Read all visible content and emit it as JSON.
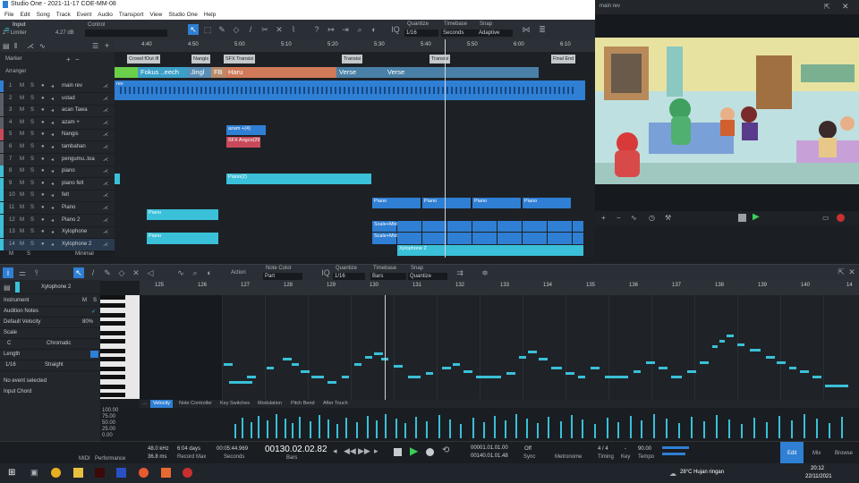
{
  "window": {
    "title": "Studio One - 2021-11-17 COE-MM-08"
  },
  "menu": [
    "File",
    "Edit",
    "Song",
    "Track",
    "Event",
    "Audio",
    "Transport",
    "View",
    "Studio One",
    "Help"
  ],
  "toolbar": {
    "input_label": "Input",
    "input_value": "2 - Limiter",
    "db_value": "4.27 dB",
    "control_label": "Control",
    "quantize_label": "Quantize",
    "quantize_value": "1/16",
    "timebase_label": "Timebase",
    "timebase_value": "Seconds",
    "snap_label": "Snap",
    "snap_value": "Adaptive"
  },
  "ruler_ticks": [
    "4:40",
    "4:50",
    "5:00",
    "5:10",
    "5:20",
    "5:30",
    "5:40",
    "5:50",
    "6:00",
    "6:10"
  ],
  "marker_label": "Marker",
  "arranger_label": "Arranger",
  "markers": [
    "Crowd fOut ifl",
    "Nangis",
    "SFX Transisi",
    "Transisi",
    "Transisi",
    "Final End"
  ],
  "arranger_sections": [
    {
      "label": "Fokus ..eech",
      "color": "#3aa0c8"
    },
    {
      "label": "Jingl",
      "color": "#5a8fb8"
    },
    {
      "label": "FB",
      "color": "#b88a6a"
    },
    {
      "label": "Haru",
      "color": "#d07a5a"
    },
    {
      "label": "Verse",
      "color": "#4a80a8"
    },
    {
      "label": "Verse",
      "color": "#4a80a8"
    }
  ],
  "tracks": [
    {
      "n": "1",
      "name": "main rev",
      "color": "#2f7fd4"
    },
    {
      "n": "2",
      "name": "ustad",
      "color": "#5a5e66"
    },
    {
      "n": "3",
      "name": "acan Tawa",
      "color": "#5a5e66"
    },
    {
      "n": "4",
      "name": "azam +",
      "color": "#5a5e66"
    },
    {
      "n": "5",
      "name": "Nangis",
      "color": "#c84a5a"
    },
    {
      "n": "6",
      "name": "tambahan",
      "color": "#5a5e66"
    },
    {
      "n": "7",
      "name": "pengumu..toa",
      "color": "#5a5e66"
    },
    {
      "n": "8",
      "name": "piano",
      "color": "#3ac0d8"
    },
    {
      "n": "9",
      "name": "piano felt",
      "color": "#3ac0d8"
    },
    {
      "n": "10",
      "name": "felt",
      "color": "#3ac0d8"
    },
    {
      "n": "11",
      "name": "Piano",
      "color": "#3ac0d8"
    },
    {
      "n": "12",
      "name": "Piano 2",
      "color": "#3ac0d8"
    },
    {
      "n": "13",
      "name": "Xylophone",
      "color": "#3ac0d8"
    },
    {
      "n": "14",
      "name": "Xylophone 2",
      "color": "#3ac0d8"
    }
  ],
  "track_footer": {
    "m": "M",
    "s": "S",
    "minimal": "Minimal"
  },
  "clip_labels": {
    "main": "rev",
    "azam": "azam +(4)",
    "sfx": "SFX Angco(29",
    "piano2": "Piano(2)",
    "piano": "Piano",
    "scale": "Scale+Mid",
    "xylo": "Xylophone 2"
  },
  "video": {
    "title": "main rev"
  },
  "editor_toolbar": {
    "action": "Action",
    "note_color_label": "Note Color",
    "note_color_value": "Part",
    "quantize_label": "Quantize",
    "quantize_value": "1/16",
    "timebase_label": "Timebase",
    "timebase_value": "Bars",
    "snap_label": "Snap",
    "snap_value": "Quantize"
  },
  "editor_left": {
    "track": "Xylophone 2",
    "instrument": "Instrument",
    "audition": "Audition Notes",
    "default_velocity": "Default Velocity",
    "default_velocity_value": "80%",
    "scale": "Scale",
    "scale_key": "C",
    "scale_mode": "Chromatic",
    "length": "Length",
    "length_value": "1/16",
    "length_mode": "Straight",
    "no_event": "No event selected",
    "input_chord": "Input Chord"
  },
  "editor_ruler": [
    "125",
    "126",
    "127",
    "128",
    "129",
    "130",
    "131",
    "132",
    "133",
    "134",
    "135",
    "136",
    "137",
    "138",
    "139",
    "140",
    "14"
  ],
  "velocity_tabs": [
    "Velocity",
    "Note Controller",
    "Key Switches",
    "Modulation",
    "Pitch Bend",
    "After Touch"
  ],
  "velocity_scale": [
    "100.00",
    "75.00",
    "50.00",
    "25.00",
    "0.00"
  ],
  "transport": {
    "midi": "MIDI",
    "performance": "Performance",
    "sample_rate": "48.0 kHz",
    "latency": "36.8 ms",
    "record_days": "6:04 days",
    "record_max": "Record Max",
    "seconds_value": "00:05:44.969",
    "seconds_label": "Seconds",
    "bars_value": "00130.02.02.82",
    "bars_label": "Bars",
    "loop_start": "00001.01.01.00",
    "loop_end": "00140.01.01.48",
    "sync_value": "Off",
    "sync_label": "Sync",
    "metronome": "Metronome",
    "timing": "Timing",
    "signature": "4 / 4",
    "key": "Key",
    "key_value": "-",
    "tempo": "90.00",
    "tempo_label": "Tempo",
    "edit": "Edit",
    "mix": "Mix",
    "browse": "Browse"
  },
  "taskbar": {
    "weather": "28°C  Hujan ringan",
    "time": "20:12",
    "date": "22/11/2021"
  }
}
